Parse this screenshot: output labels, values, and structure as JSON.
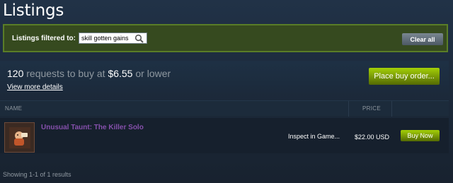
{
  "page": {
    "title": "Listings"
  },
  "filter": {
    "label": "Listings filtered to:",
    "query_value": "skill gotten gains",
    "search_icon": "search-icon",
    "clear_label": "Clear all"
  },
  "buy_order": {
    "count": "120",
    "text_requests": " requests to buy at ",
    "price": "$6.55",
    "text_suffix": " or lower",
    "view_details": "View more details",
    "place_label": "Place buy order..."
  },
  "table": {
    "headers": {
      "name": "NAME",
      "price": "PRICE"
    },
    "rows": [
      {
        "item_name": "Unusual Taunt: The Killer Solo",
        "inspect_label": "Inspect in Game...",
        "price": "$22.00 USD",
        "buy_label": "Buy Now"
      }
    ]
  },
  "footer": {
    "results": "Showing 1-1 of 1 results"
  },
  "colors": {
    "accent_green": "#a4d007",
    "unusual_purple": "#8650ac",
    "background": "#1b2838"
  }
}
